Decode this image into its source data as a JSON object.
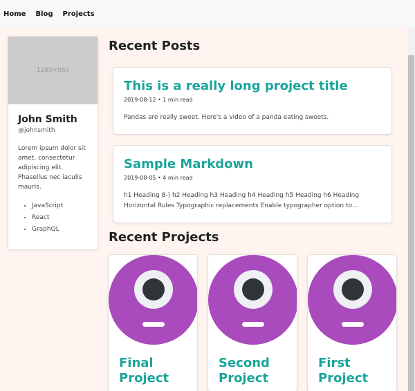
{
  "nav": {
    "items": [
      "Home",
      "Blog",
      "Projects"
    ]
  },
  "profile": {
    "image_placeholder": "1280×960",
    "name": "John Smith",
    "handle": "@johnsmith",
    "bio": "Lorem ipsum dolor sit amet, consectetur adipiscing elit. Phasellus nec iaculis mauris.",
    "skills": [
      "JavaScript",
      "React",
      "GraphQL"
    ]
  },
  "recent_posts": {
    "heading": "Recent Posts",
    "posts": [
      {
        "title": "This is a really long project title",
        "meta": "2019-08-12 • 1 min read",
        "excerpt": "Pandas are really sweet. Here's a video of a panda eating sweets."
      },
      {
        "title": "Sample Markdown",
        "meta": "2019-08-05 • 4 min read",
        "excerpt": "h1 Heading 8-) h2 Heading h3 Heading h4 Heading h5 Heading h6 Heading Horizontal Rules Typographic replacements Enable typographer option to..."
      }
    ]
  },
  "recent_projects": {
    "heading": "Recent Projects",
    "projects": [
      {
        "title": "Final Project"
      },
      {
        "title": "Second Project"
      },
      {
        "title": "First Project"
      }
    ]
  },
  "colors": {
    "accent": "#1aa59a",
    "page_bg": "#fff4ef",
    "project_art": "#a94bbd"
  }
}
